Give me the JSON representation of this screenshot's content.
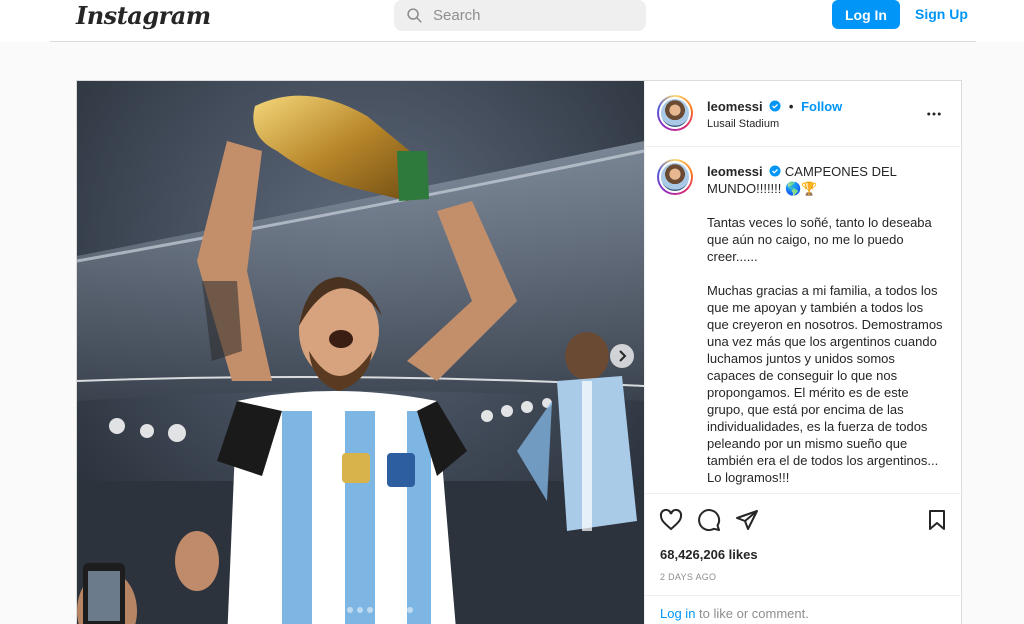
{
  "nav": {
    "logo": "Instagram",
    "search_placeholder": "Search",
    "login_label": "Log In",
    "signup_label": "Sign Up"
  },
  "post": {
    "username": "leomessi",
    "follow_label": "Follow",
    "location": "Lusail Stadium",
    "caption_first": "CAMPEONES DEL MUNDO!!!!!!! 🌎🏆",
    "caption_paragraphs": [
      "Tantas veces lo soñé, tanto lo deseaba que aún no caigo, no me lo puedo creer......",
      "Muchas gracias a mi familia, a todos los que me apoyan y también a todos los que creyeron en nosotros. Demostramos una vez más que los argentinos cuando luchamos juntos y unidos somos capaces de conseguir lo que nos propongamos. El mérito es de este grupo, que está por encima de las individualidades, es la fuerza de todos peleando por un mismo sueño que también era el de todos los argentinos... Lo logramos!!!"
    ],
    "likes": "68,426,206 likes",
    "date": "2 DAYS AGO",
    "login_link": "Log in",
    "login_suffix": " to like or comment."
  },
  "colors": {
    "accent": "#0095f6",
    "text": "#262626",
    "muted": "#8e8e8e",
    "border": "#dbdbdb"
  },
  "icons": [
    "search-icon",
    "verified-badge-icon",
    "more-options-icon",
    "heart-icon",
    "comment-icon",
    "share-icon",
    "bookmark-icon",
    "chevron-right-icon"
  ]
}
